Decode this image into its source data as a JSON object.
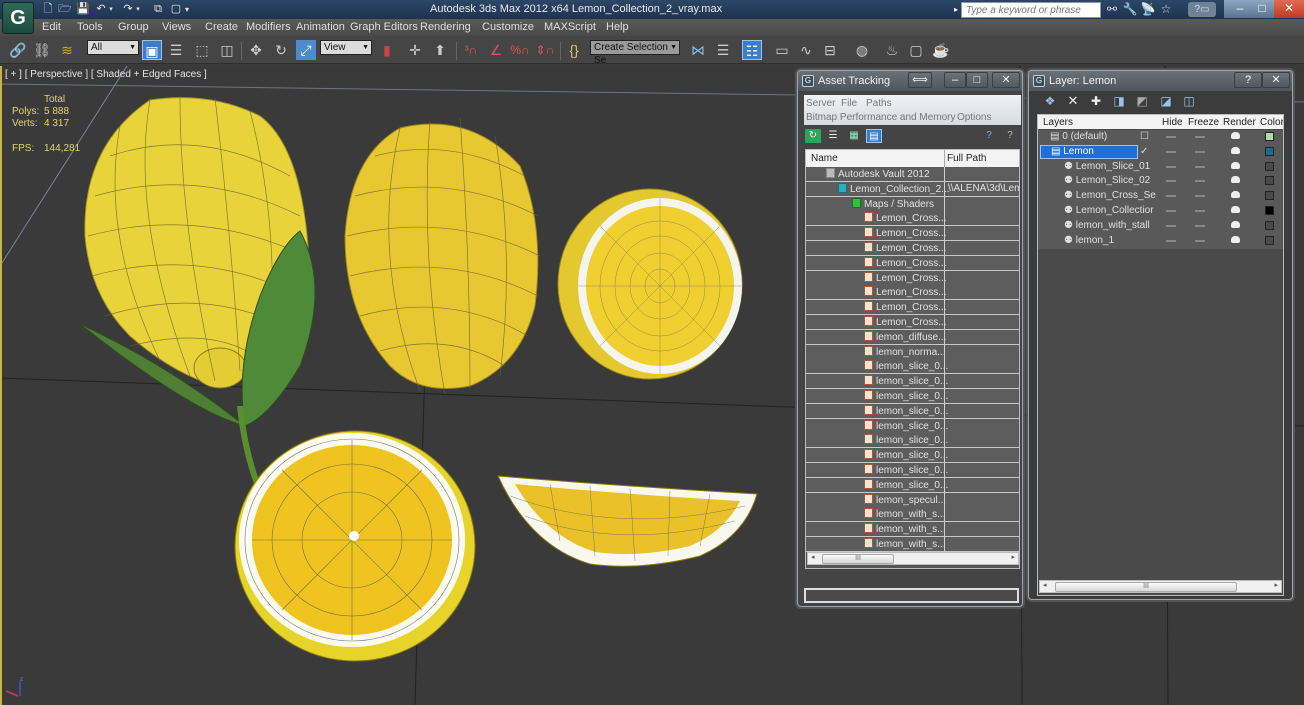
{
  "app": {
    "title": "Autodesk 3ds Max  2012 x64     Lemon_Collection_2_vray.max",
    "logo": "G",
    "search_placeholder": "Type a keyword or phrase",
    "window_controls": {
      "minimize": "–",
      "maximize": "□",
      "close": "✕"
    }
  },
  "quick_access": [
    "new-icon",
    "open-icon",
    "save-icon",
    "undo-icon",
    "redo-icon",
    "hold-icon",
    "project-icon"
  ],
  "menu": [
    "Edit",
    "Tools",
    "Group",
    "Views",
    "Create",
    "Modifiers",
    "Animation",
    "Graph Editors",
    "Rendering",
    "Customize",
    "MAXScript",
    "Help"
  ],
  "toolbar": {
    "filter_value": "All",
    "refcoord_value": "View",
    "selection_set_value": "Create Selection Se",
    "icons": {
      "link": "🔗",
      "unlink": "⛓",
      "bind": "≋",
      "select": "▣",
      "select_by_name": "☰",
      "rect_region": "⬚",
      "window_crossing": "◫",
      "move": "✥",
      "rotate": "↻",
      "scale": "⤢",
      "pivot": "▮",
      "manipulate": "✛",
      "keyboard": "⬆",
      "snap3": "³∩",
      "angle_snap": "∠",
      "percent_snap": "%∩",
      "spinner_snap": "⇕∩",
      "edit_named_sets": "{}",
      "mirror": "⋈",
      "align": "☰",
      "layer_manager": "☷",
      "ribbon": "▭",
      "curve_editor": "∿",
      "schematic": "⊟",
      "material_editor": "◍",
      "render_setup": "♨",
      "rendered_frame": "▢",
      "render": "☕"
    }
  },
  "viewport": {
    "label": "[ + ] [ Perspective ] [ Shaded + Edged Faces ]",
    "stats": {
      "total_label": "Total",
      "polys_label": "Polys:",
      "polys": "5 888",
      "verts_label": "Verts:",
      "verts": "4 317",
      "fps_label": "FPS:",
      "fps": "144,281"
    },
    "axis": {
      "z": "z",
      "x": "x"
    }
  },
  "asset_tracking": {
    "title": "Asset Tracking",
    "title_buttons": {
      "dock": "⟺",
      "minimize": "–",
      "maximize": "□",
      "close": "✕"
    },
    "menu_row1": [
      "Server",
      "File",
      "Paths"
    ],
    "menu_row2": [
      "Bitmap Performance and Memory",
      "Options"
    ],
    "columns": {
      "name": "Name",
      "full_path": "Full Path"
    },
    "rows": [
      {
        "name": "Autodesk Vault 2012",
        "path": "",
        "level": 0,
        "icon": "vault"
      },
      {
        "name": "Lemon_Collection_2...",
        "path": "\\\\ALENA\\3d\\Lem",
        "level": 1,
        "icon": "max"
      },
      {
        "name": "Maps / Shaders",
        "path": "",
        "level": 2,
        "icon": "maps"
      },
      {
        "name": "Lemon_Cross...",
        "path": "",
        "level": 3,
        "icon": "file"
      },
      {
        "name": "Lemon_Cross...",
        "path": "",
        "level": 3,
        "icon": "file"
      },
      {
        "name": "Lemon_Cross...",
        "path": "",
        "level": 3,
        "icon": "file"
      },
      {
        "name": "Lemon_Cross...",
        "path": "",
        "level": 3,
        "icon": "file"
      },
      {
        "name": "Lemon_Cross...",
        "path": "",
        "level": 3,
        "icon": "file"
      },
      {
        "name": "Lemon_Cross...",
        "path": "",
        "level": 3,
        "icon": "file"
      },
      {
        "name": "Lemon_Cross...",
        "path": "",
        "level": 3,
        "icon": "file"
      },
      {
        "name": "Lemon_Cross...",
        "path": "",
        "level": 3,
        "icon": "file"
      },
      {
        "name": "lemon_diffuse...",
        "path": "",
        "level": 3,
        "icon": "file"
      },
      {
        "name": "lemon_norma...",
        "path": "",
        "level": 3,
        "icon": "file"
      },
      {
        "name": "lemon_slice_0...",
        "path": "",
        "level": 3,
        "icon": "file"
      },
      {
        "name": "lemon_slice_0...",
        "path": "",
        "level": 3,
        "icon": "file"
      },
      {
        "name": "lemon_slice_0...",
        "path": "",
        "level": 3,
        "icon": "file"
      },
      {
        "name": "lemon_slice_0...",
        "path": "",
        "level": 3,
        "icon": "file"
      },
      {
        "name": "lemon_slice_0...",
        "path": "",
        "level": 3,
        "icon": "file"
      },
      {
        "name": "lemon_slice_0...",
        "path": "",
        "level": 3,
        "icon": "file"
      },
      {
        "name": "lemon_slice_0...",
        "path": "",
        "level": 3,
        "icon": "file"
      },
      {
        "name": "lemon_slice_0...",
        "path": "",
        "level": 3,
        "icon": "file"
      },
      {
        "name": "lemon_slice_0...",
        "path": "",
        "level": 3,
        "icon": "file"
      },
      {
        "name": "lemon_specul...",
        "path": "",
        "level": 3,
        "icon": "file"
      },
      {
        "name": "lemon_with_s...",
        "path": "",
        "level": 3,
        "icon": "file"
      },
      {
        "name": "lemon_with_s...",
        "path": "",
        "level": 3,
        "icon": "file"
      },
      {
        "name": "lemon_with_s...",
        "path": "",
        "level": 3,
        "icon": "file"
      }
    ],
    "scroll_grip": "III",
    "status_text": ""
  },
  "layer_manager": {
    "title": "Layer: Lemon",
    "title_buttons": {
      "help": "?",
      "close": "✕"
    },
    "tool_icons": [
      "create-layer-icon",
      "delete-layer-icon",
      "add-to-layer-icon",
      "select-objects-icon",
      "highlight-layer-icon",
      "hide-all-icon",
      "freeze-all-icon"
    ],
    "tool_glyphs": [
      "❖",
      "✕",
      "✚",
      "◨",
      "◩",
      "◪",
      "◫"
    ],
    "columns": {
      "layers": "Layers",
      "hide": "Hide",
      "freeze": "Freeze",
      "render": "Render",
      "color": "Color"
    },
    "rows": [
      {
        "name": "0 (default)",
        "level": 0,
        "type": "layer",
        "current": "☐",
        "color": "#a8e0a0",
        "selected": false
      },
      {
        "name": "Lemon",
        "level": 0,
        "type": "layer",
        "current": "✓",
        "color": "#1a6e8c",
        "selected": true
      },
      {
        "name": "Lemon_Slice_01",
        "level": 1,
        "type": "object",
        "current": "",
        "color": "#4a4a4a",
        "selected": false
      },
      {
        "name": "Lemon_Slice_02",
        "level": 1,
        "type": "object",
        "current": "",
        "color": "#4a4a4a",
        "selected": false
      },
      {
        "name": "Lemon_Cross_Se",
        "level": 1,
        "type": "object",
        "current": "",
        "color": "#4a4a4a",
        "selected": false
      },
      {
        "name": "Lemon_Collectior",
        "level": 1,
        "type": "object",
        "current": "",
        "color": "#000000",
        "selected": false
      },
      {
        "name": "lemon_with_stall",
        "level": 1,
        "type": "object",
        "current": "",
        "color": "#4a4a4a",
        "selected": false
      },
      {
        "name": "lemon_1",
        "level": 1,
        "type": "object",
        "current": "",
        "color": "#4a4a4a",
        "selected": false
      }
    ],
    "scroll_grip": "III"
  },
  "colors": {
    "accent": "#3d7ec9",
    "selected_row": "#1f6fd6",
    "viewport_bg": "#3a3a3a",
    "active_viewport_border": "#c9b640",
    "stats_text": "#e0d66a"
  }
}
